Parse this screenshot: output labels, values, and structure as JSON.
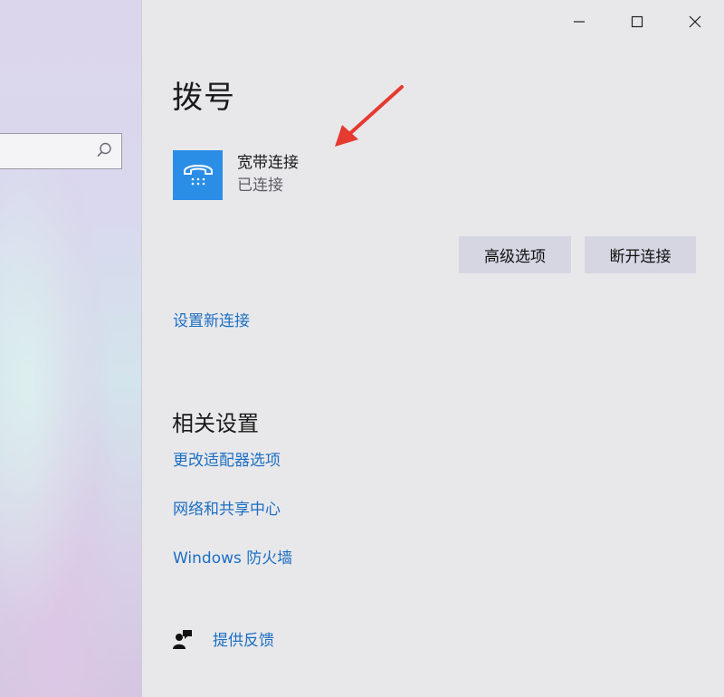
{
  "window": {
    "controls": {
      "minimize": "—",
      "maximize": "☐",
      "close": "✕"
    }
  },
  "sidebar": {
    "search": {
      "placeholder": "",
      "icon": "search-icon"
    }
  },
  "page": {
    "title": "拨号",
    "connection": {
      "name": "宽带连接",
      "status": "已连接",
      "icon": "dialup-phone-icon",
      "icon_color": "#2a8ee6"
    },
    "buttons": {
      "advanced": "高级选项",
      "disconnect": "断开连接"
    },
    "new_connection_link": "设置新连接",
    "related": {
      "title": "相关设置",
      "links": [
        "更改适配器选项",
        "网络和共享中心",
        "Windows 防火墙"
      ]
    },
    "feedback": {
      "label": "提供反馈",
      "icon": "feedback-icon"
    }
  },
  "colors": {
    "accent": "#2a8ee6",
    "link": "#1d6fc2",
    "annotation_arrow": "#e53a30"
  }
}
